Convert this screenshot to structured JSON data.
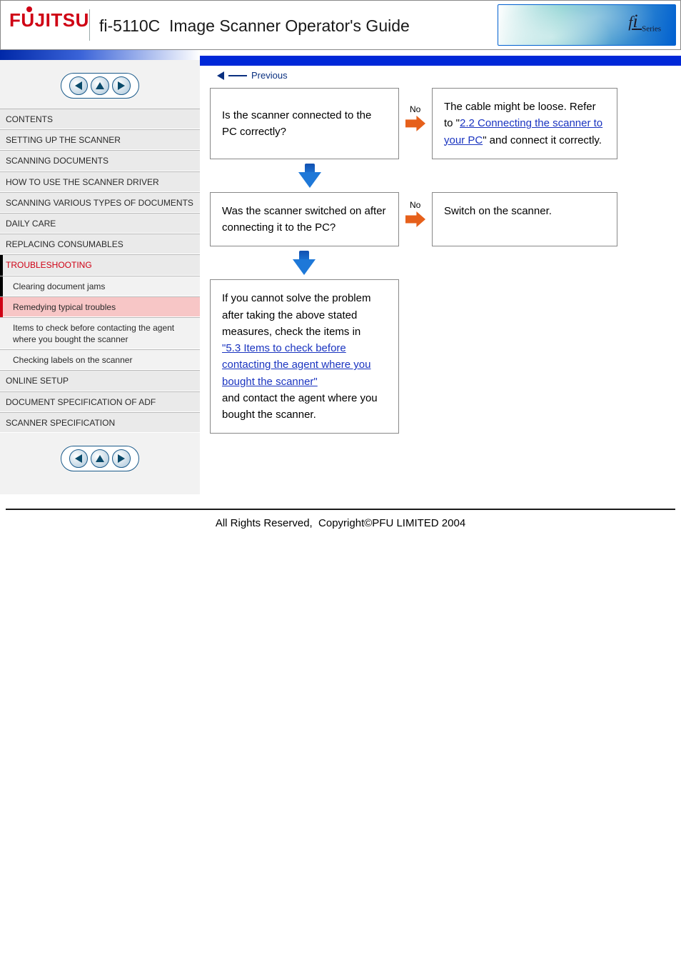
{
  "header": {
    "logo_text": "FUJITSU",
    "title": "fi-5110C  Image Scanner Operator's Guide",
    "badge_text": "fi Series"
  },
  "nav_pill": {
    "prev": "previous-page",
    "up": "parent-page",
    "next": "next-page"
  },
  "menu": [
    {
      "label": "CONTENTS",
      "level": 1,
      "active": false,
      "red": false
    },
    {
      "label": "SETTING UP THE SCANNER",
      "level": 1,
      "active": false,
      "red": false
    },
    {
      "label": "SCANNING DOCUMENTS",
      "level": 1,
      "active": false,
      "red": false
    },
    {
      "label": "HOW TO USE THE SCANNER DRIVER",
      "level": 1,
      "active": false,
      "red": false
    },
    {
      "label": "SCANNING VARIOUS TYPES OF DOCUMENTS",
      "level": 1,
      "active": false,
      "red": false
    },
    {
      "label": "DAILY CARE",
      "level": 1,
      "active": false,
      "red": false
    },
    {
      "label": "REPLACING CONSUMABLES",
      "level": 1,
      "active": false,
      "red": false
    },
    {
      "label": "TROUBLESHOOTING",
      "level": 1,
      "active": false,
      "red": true,
      "section_start": true
    },
    {
      "label": "Clearing document jams",
      "level": 2,
      "active": false,
      "red": false
    },
    {
      "label": "Remedying typical troubles",
      "level": 2,
      "active": true,
      "red": false,
      "accent": true
    },
    {
      "label": "Items to check before contacting the agent where you bought the scanner",
      "level": 2,
      "active": false,
      "red": false
    },
    {
      "label": "Checking labels on the scanner",
      "level": 2,
      "active": false,
      "red": false
    },
    {
      "label": "ONLINE SETUP",
      "level": 1,
      "active": false,
      "red": false
    },
    {
      "label": "DOCUMENT SPECIFICATION OF ADF",
      "level": 1,
      "active": false,
      "red": false
    },
    {
      "label": "SCANNER SPECIFICATION",
      "level": 1,
      "active": false,
      "red": false
    }
  ],
  "flow": {
    "back_label": "Previous",
    "q1": "Is the scanner connected to the PC correctly?",
    "a1_prefix": "The cable might be loose. Refer to \"",
    "a1_link": "2.2 Connecting the scanner to your PC",
    "a1_suffix": "\" and connect it correctly.",
    "a1_no_label": "No",
    "q2": "Was the scanner switched on after connecting it to the PC?",
    "a2": "Switch on the scanner.",
    "a2_no_label": "No",
    "final_prefix": "If you cannot solve the problem after taking the above stated measures, check the items in ",
    "final_link1": "\"5.3 Items to check before contacting the agent where you bought the scanner\"",
    "final_mid": " and contact the agent where you bought the scanner.",
    "final_link2": ""
  },
  "footer": {
    "copyright": "All Rights Reserved,  Copyright©PFU LIMITED 2004"
  }
}
